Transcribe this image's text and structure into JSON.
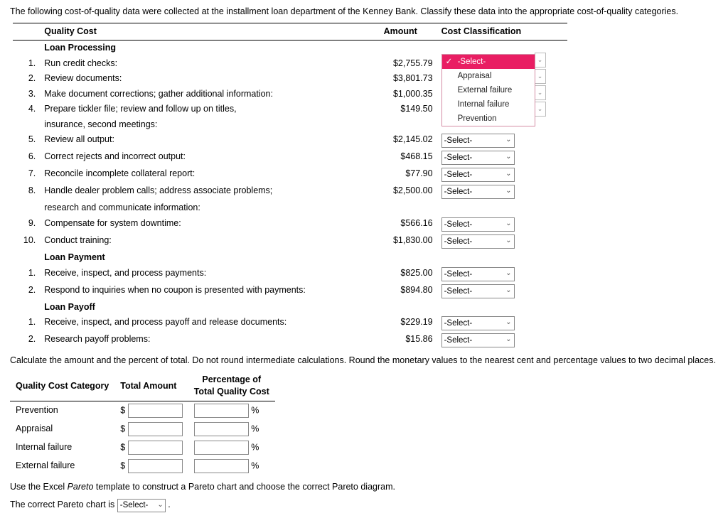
{
  "intro": "The following cost-of-quality data were collected at the installment loan department of the Kenney Bank. Classify these data into the appropriate cost-of-quality categories.",
  "headers": {
    "cost": "Quality Cost",
    "amount": "Amount",
    "classif": "Cost Classification"
  },
  "sections": {
    "loan_processing": "Loan Processing",
    "loan_payment": "Loan Payment",
    "loan_payoff": "Loan Payoff"
  },
  "rows": {
    "lp1": {
      "n": "1.",
      "label": "Run credit checks:",
      "amount": "$2,755.79"
    },
    "lp2": {
      "n": "2.",
      "label": "Review documents:",
      "amount": "$3,801.73"
    },
    "lp3": {
      "n": "3.",
      "label": "Make document corrections; gather additional information:",
      "amount": "$1,000.35"
    },
    "lp4": {
      "n": "4.",
      "label": "Prepare tickler file; review and follow up on titles,",
      "amount": "$149.50",
      "label2": "insurance, second meetings:"
    },
    "lp5": {
      "n": "5.",
      "label": "Review all output:",
      "amount": "$2,145.02"
    },
    "lp6": {
      "n": "6.",
      "label": "Correct rejects and incorrect output:",
      "amount": "$468.15"
    },
    "lp7": {
      "n": "7.",
      "label": "Reconcile incomplete collateral report:",
      "amount": "$77.90"
    },
    "lp8": {
      "n": "8.",
      "label": "Handle dealer problem calls; address associate problems;",
      "amount": "$2,500.00",
      "label2": "research and communicate information:"
    },
    "lp9": {
      "n": "9.",
      "label": "Compensate for system downtime:",
      "amount": "$566.16"
    },
    "lp10": {
      "n": "10.",
      "label": "Conduct training:",
      "amount": "$1,830.00"
    },
    "pay1": {
      "n": "1.",
      "label": "Receive, inspect, and process payments:",
      "amount": "$825.00"
    },
    "pay2": {
      "n": "2.",
      "label": "Respond to inquiries when no coupon is presented with payments:",
      "amount": "$894.80"
    },
    "po1": {
      "n": "1.",
      "label": "Receive, inspect, and process payoff and release documents:",
      "amount": "$229.19"
    },
    "po2": {
      "n": "2.",
      "label": "Research payoff problems:",
      "amount": "$15.86"
    }
  },
  "select_placeholder": "-Select-",
  "dropdown_options": [
    "-Select-",
    "Appraisal",
    "External failure",
    "Internal failure",
    "Prevention"
  ],
  "calc_instruction": "Calculate the amount and the percent of total. Do not round intermediate calculations. Round the monetary values to the nearest cent and percentage values to two decimal places.",
  "cat_headers": {
    "cat": "Quality Cost Category",
    "tot": "Total Amount",
    "pct": "Percentage of",
    "pct2": "Total Quality Cost"
  },
  "cats": [
    "Prevention",
    "Appraisal",
    "Internal failure",
    "External failure"
  ],
  "dollar": "$",
  "pct": "%",
  "pareto1": "Use the Excel ",
  "pareto_em": "Pareto",
  "pareto2": " template to construct a Pareto chart and choose the correct Pareto diagram.",
  "pareto_ans": "The correct Pareto chart is ",
  "period": "."
}
